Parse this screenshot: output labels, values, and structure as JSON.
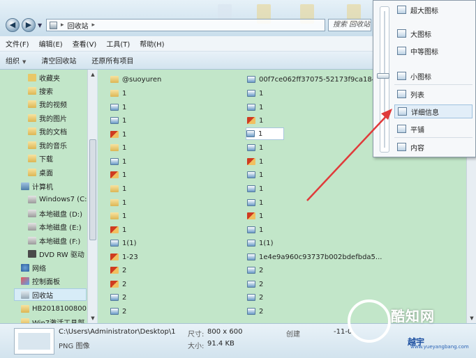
{
  "address": {
    "location": "回收站",
    "search_placeholder": "搜索 回收站"
  },
  "menu": [
    "文件(F)",
    "编辑(E)",
    "查看(V)",
    "工具(T)",
    "帮助(H)"
  ],
  "toolbar": {
    "organize": "组织",
    "empty_bin": "清空回收站",
    "restore_all": "还原所有项目"
  },
  "sidebar": {
    "items": [
      {
        "label": "收藏夹",
        "icon": "favorites-icon"
      },
      {
        "label": "搜索",
        "icon": "folder-icon"
      },
      {
        "label": "我的视频",
        "icon": "folder-icon"
      },
      {
        "label": "我的图片",
        "icon": "folder-icon"
      },
      {
        "label": "我的文档",
        "icon": "folder-icon"
      },
      {
        "label": "我的音乐",
        "icon": "folder-icon"
      },
      {
        "label": "下载",
        "icon": "folder-icon"
      },
      {
        "label": "桌面",
        "icon": "folder-icon"
      },
      {
        "label": "计算机",
        "icon": "computer-icon"
      },
      {
        "label": "Windows7 (C:",
        "icon": "disk-icon"
      },
      {
        "label": "本地磁盘 (D:)",
        "icon": "disk-icon"
      },
      {
        "label": "本地磁盘 (E:)",
        "icon": "disk-icon"
      },
      {
        "label": "本地磁盘 (F:)",
        "icon": "disk-icon"
      },
      {
        "label": "DVD RW 驱动",
        "icon": "dvd-icon"
      },
      {
        "label": "网络",
        "icon": "network-icon"
      },
      {
        "label": "控制面板",
        "icon": "control-panel-icon"
      },
      {
        "label": "回收站",
        "icon": "recycle-bin-icon"
      },
      {
        "label": "HB2018100800",
        "icon": "folder-icon"
      },
      {
        "label": "Win7激活工具部",
        "icon": "folder-icon"
      }
    ]
  },
  "files": {
    "col1": [
      {
        "name": "@suoyuren",
        "icon": "folder-icon"
      },
      {
        "name": "1",
        "icon": "folder-icon"
      },
      {
        "name": "1",
        "icon": "image-icon"
      },
      {
        "name": "1",
        "icon": "image-icon"
      },
      {
        "name": "1",
        "icon": "picture-icon"
      },
      {
        "name": "1",
        "icon": "folder-icon"
      },
      {
        "name": "1",
        "icon": "image-icon"
      },
      {
        "name": "1",
        "icon": "picture-icon"
      },
      {
        "name": "1",
        "icon": "folder-icon"
      },
      {
        "name": "1",
        "icon": "folder-icon"
      },
      {
        "name": "1",
        "icon": "folder-icon"
      },
      {
        "name": "1",
        "icon": "picture-icon"
      },
      {
        "name": "1(1)",
        "icon": "image-icon"
      },
      {
        "name": "1-23",
        "icon": "picture-icon"
      },
      {
        "name": "2",
        "icon": "picture-icon"
      },
      {
        "name": "2",
        "icon": "picture-icon"
      },
      {
        "name": "2",
        "icon": "image-icon"
      },
      {
        "name": "2",
        "icon": "image-icon"
      }
    ],
    "col2": [
      {
        "name": "00f7ce062ff37075-52173f9ca184...",
        "icon": "image-icon"
      },
      {
        "name": "1",
        "icon": "image-icon"
      },
      {
        "name": "1",
        "icon": "image-icon"
      },
      {
        "name": "1",
        "icon": "picture-icon"
      },
      {
        "name": "1",
        "icon": "image-icon"
      },
      {
        "name": "1",
        "icon": "image-icon"
      },
      {
        "name": "1",
        "icon": "picture-icon"
      },
      {
        "name": "1",
        "icon": "image-icon"
      },
      {
        "name": "1",
        "icon": "image-icon"
      },
      {
        "name": "1",
        "icon": "image-icon"
      },
      {
        "name": "1",
        "icon": "picture-icon"
      },
      {
        "name": "1",
        "icon": "image-icon"
      },
      {
        "name": "1(1)",
        "icon": "image-icon"
      },
      {
        "name": "1e4e9a960c93737b002bdefbda5...",
        "icon": "image-icon"
      },
      {
        "name": "2",
        "icon": "image-icon"
      },
      {
        "name": "2",
        "icon": "image-icon"
      },
      {
        "name": "2",
        "icon": "image-icon"
      },
      {
        "name": "2",
        "icon": "image-icon"
      }
    ]
  },
  "details": {
    "path": "C:\\Users\\Administrator\\Desktop\\1",
    "type": "PNG 图像",
    "dimensions_label": "尺寸:",
    "dimensions_value": "800 x 600",
    "size_label": "大小:",
    "size_value": "91.4 KB",
    "created_label": "创建",
    "created_value": "-11-0"
  },
  "view_menu": {
    "items": [
      "超大图标",
      "大图标",
      "中等图标",
      "小图标",
      "列表",
      "详细信息",
      "平铺",
      "内容"
    ],
    "highlighted": "详细信息"
  },
  "watermark": {
    "text": "酷知网",
    "brand": "越宇",
    "url": "www.yueyangbang.com"
  },
  "colors": {
    "content_bg": "#c2e6c9",
    "arrow": "#e03a3a",
    "selection": "#d7ecf7"
  }
}
